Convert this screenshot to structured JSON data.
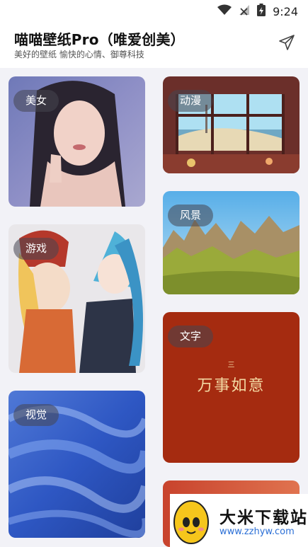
{
  "status_bar": {
    "time": "9:24",
    "icons": [
      "wifi-icon",
      "no-signal-icon",
      "battery-charging-icon"
    ]
  },
  "header": {
    "title": "喵喵壁纸Pro（唯爱创美）",
    "subtitle": "美好的壁纸 愉快的心情、御尊科技",
    "share_icon": "paper-plane-icon"
  },
  "categories": [
    {
      "label": "美女"
    },
    {
      "label": "动漫"
    },
    {
      "label": "风景"
    },
    {
      "label": "游戏"
    },
    {
      "label": "文字",
      "artwork_text": "万事如意"
    },
    {
      "label": "视觉"
    }
  ],
  "watermark": {
    "name": "大米下载站",
    "url": "www.zzhyw.com"
  },
  "colors": {
    "background": "#f2f2f7",
    "chip": "rgba(70,70,80,0.55)",
    "text_card": "#a52b10"
  }
}
